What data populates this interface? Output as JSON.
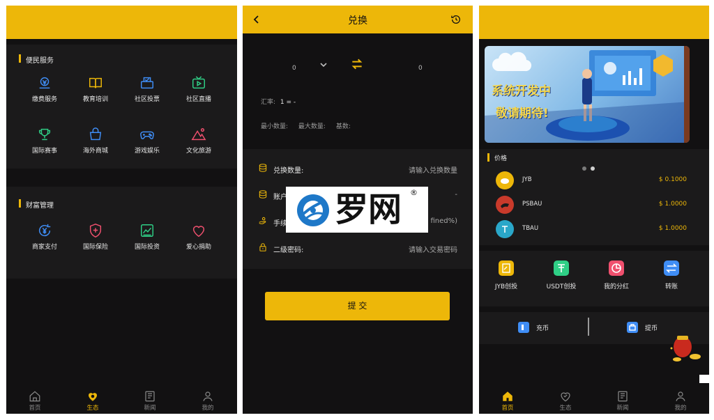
{
  "colors": {
    "accent": "#edb709",
    "bg": "#121112",
    "card": "#1b1a1b"
  },
  "eco": {
    "section1_title": "便民服务",
    "section1_items": [
      {
        "label": "缴费服务",
        "icon": "payment-icon",
        "color": "#3f8df5"
      },
      {
        "label": "教育培训",
        "icon": "book-icon",
        "color": "#edb709"
      },
      {
        "label": "社区投票",
        "icon": "vote-icon",
        "color": "#3f8df5"
      },
      {
        "label": "社区直播",
        "icon": "live-icon",
        "color": "#2fcf86"
      },
      {
        "label": "国际赛事",
        "icon": "trophy-icon",
        "color": "#2fcf86"
      },
      {
        "label": "海外商城",
        "icon": "shop-bag-icon",
        "color": "#3f8df5"
      },
      {
        "label": "游戏娱乐",
        "icon": "gamepad-icon",
        "color": "#3f8df5"
      },
      {
        "label": "文化旅游",
        "icon": "travel-icon",
        "color": "#f0506e"
      }
    ],
    "section2_title": "财富管理",
    "section2_items": [
      {
        "label": "商家支付",
        "icon": "yen-icon",
        "color": "#3f8df5"
      },
      {
        "label": "国际保险",
        "icon": "shield-icon",
        "color": "#f0506e"
      },
      {
        "label": "国际投资",
        "icon": "chart-icon",
        "color": "#2fcf86"
      },
      {
        "label": "爱心捐助",
        "icon": "heart-icon",
        "color": "#f0506e"
      }
    ],
    "tabs": [
      "首页",
      "生态",
      "新闻",
      "我的"
    ],
    "active_tab": "生态"
  },
  "exchange": {
    "title": "兑换",
    "from_amount": "0",
    "to_amount": "0",
    "rate_label": "汇率:",
    "rate_value": "1 = -",
    "min_label": "最小数量:",
    "max_label": "最大数量:",
    "base_label": "基数:",
    "rows": [
      {
        "label": "兑换数量:",
        "placeholder": "请输入兑换数量"
      },
      {
        "label": "账户",
        "placeholder": "-"
      },
      {
        "label": "手续",
        "placeholder": "fined%)"
      },
      {
        "label": "二级密码:",
        "placeholder": "请输入交易密码"
      }
    ],
    "submit": "提 交",
    "watermark_text": "罗网",
    "watermark_mark": "®"
  },
  "home": {
    "banner_line1": "系统开发中",
    "banner_line2": "敬请期待!",
    "prices_title": "价格",
    "coins": [
      {
        "name": "JYB",
        "price": "$ 0.1000",
        "color": "#edb709"
      },
      {
        "name": "PSBAU",
        "price": "$ 1.0000",
        "color": "#c93a2b"
      },
      {
        "name": "TBAU",
        "price": "$ 1.0000",
        "color": "#2aa7c9"
      }
    ],
    "quick": [
      {
        "label": "JYB创投",
        "color": "#edb709"
      },
      {
        "label": "USDT创投",
        "color": "#2fcf86"
      },
      {
        "label": "我的分红",
        "color": "#f0506e"
      },
      {
        "label": "转账",
        "color": "#3f8df5"
      }
    ],
    "deposit": "充币",
    "withdraw": "提币",
    "tabs": [
      "首页",
      "生态",
      "新闻",
      "我的"
    ],
    "active_tab": "首页"
  }
}
